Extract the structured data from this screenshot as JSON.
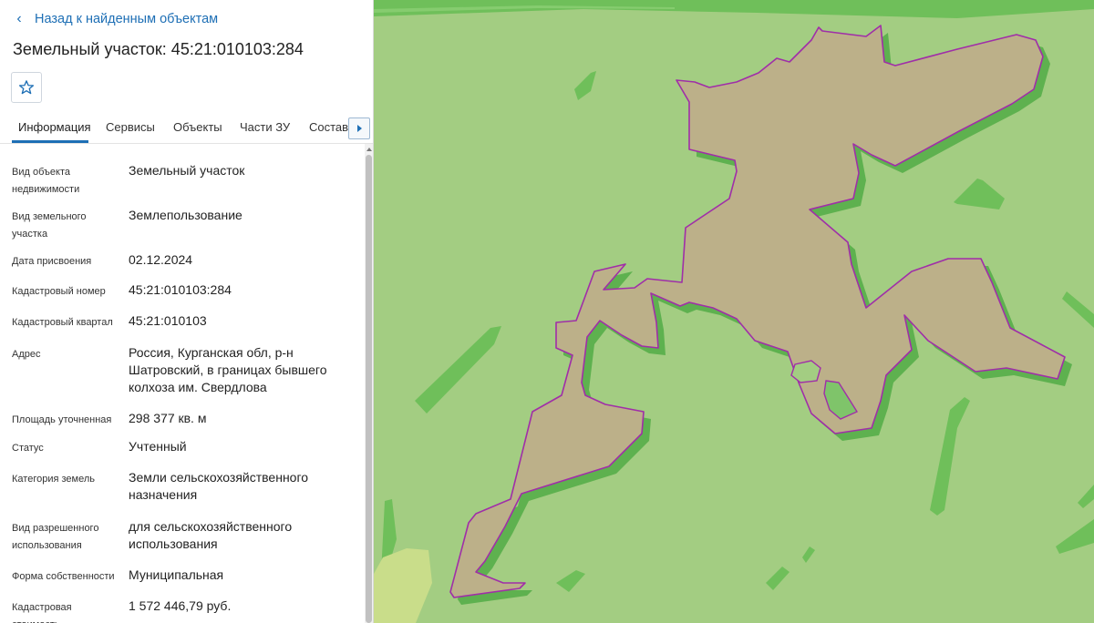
{
  "header": {
    "back_label": "Назад к найденным объектам",
    "title": "Земельный участок: 45:21:010103:284"
  },
  "tabs": [
    {
      "label": "Информация",
      "active": true
    },
    {
      "label": "Сервисы"
    },
    {
      "label": "Объекты"
    },
    {
      "label": "Части ЗУ"
    },
    {
      "label": "Состав"
    }
  ],
  "details": [
    {
      "label": "Вид объекта недвижимости",
      "value": "Земельный участок"
    },
    {
      "label": "Вид земельного участка",
      "value": "Землепользование"
    },
    {
      "label": "Дата присвоения",
      "value": "02.12.2024"
    },
    {
      "label": "Кадастровый номер",
      "value": "45:21:010103:284"
    },
    {
      "label": "Кадастровый квартал",
      "value": "45:21:010103"
    },
    {
      "label": "Адрес",
      "value": "Россия, Курганская обл, р-н Шатровский, в границах бывшего колхоза им. Свердлова"
    },
    {
      "label": "Площадь уточненная",
      "value": "298 377 кв. м"
    },
    {
      "label": "Статус",
      "value": "Учтенный"
    },
    {
      "label": "Категория земель",
      "value": "Земли сельскохозяйственного назначения"
    },
    {
      "label": "Вид разрешенного использования",
      "value": "для сельскохозяйственного использования"
    },
    {
      "label": "Форма собственности",
      "value": "Муниципальная"
    },
    {
      "label": "Кадастровая стоимость",
      "value": "1 572 446,79 руб."
    }
  ],
  "colors": {
    "accent": "#1e6fb5",
    "map_background": "#a3cd82",
    "map_green_features": "#6fbf5a",
    "parcel_fill": "#bcb089",
    "parcel_border": "#a02ea8"
  },
  "icons": {
    "back": "chevron-left-icon",
    "favorite": "star-icon",
    "tabs_scroll": "caret-right-icon"
  }
}
